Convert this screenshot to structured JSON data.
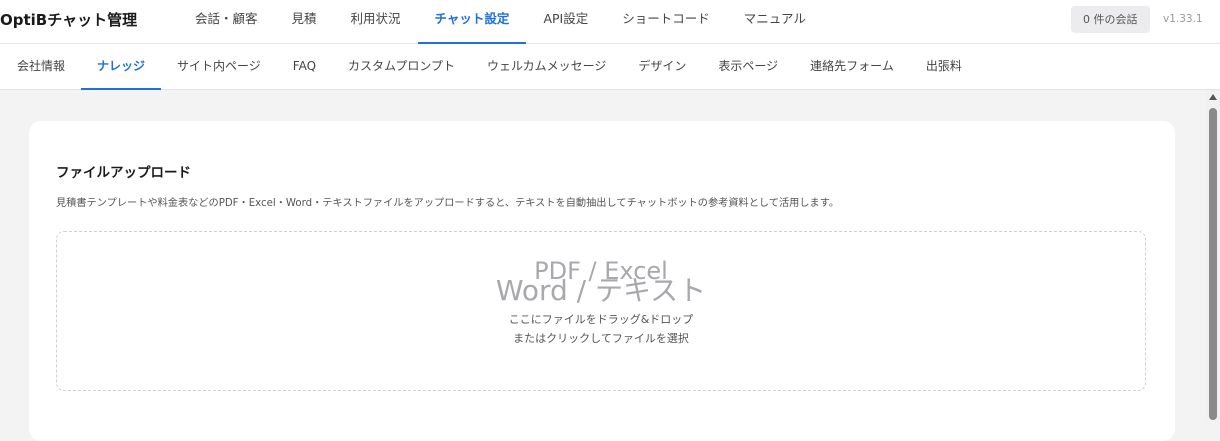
{
  "app": {
    "title": "OptiBチャット管理",
    "session_badge": "0 件の会話",
    "version": "v1.33.1"
  },
  "top_nav": {
    "items": [
      {
        "label": "会話・顧客"
      },
      {
        "label": "見積"
      },
      {
        "label": "利用状況"
      },
      {
        "label": "チャット設定",
        "active": true
      },
      {
        "label": "API設定"
      },
      {
        "label": "ショートコード"
      },
      {
        "label": "マニュアル"
      }
    ]
  },
  "sub_nav": {
    "items": [
      {
        "label": "会社情報"
      },
      {
        "label": "ナレッジ",
        "active": true
      },
      {
        "label": "サイト内ページ"
      },
      {
        "label": "FAQ"
      },
      {
        "label": "カスタムプロンプト"
      },
      {
        "label": "ウェルカムメッセージ"
      },
      {
        "label": "デザイン"
      },
      {
        "label": "表示ページ"
      },
      {
        "label": "連絡先フォーム"
      },
      {
        "label": "出張料"
      }
    ]
  },
  "upload": {
    "title": "ファイルアップロード",
    "description": "見積書テンプレートや料金表などのPDF・Excel・Word・テキストファイルをアップロードすると、テキストを自動抽出してチャットボットの参考資料として活用します。",
    "icon_line1": "PDF / Excel",
    "icon_line2": "Word / テキスト",
    "hint_line1": "ここにファイルをドラッグ&ドロップ",
    "hint_line2": "またはクリックしてファイルを選択"
  },
  "colors": {
    "accent": "#1f6fe0",
    "background": "#f3f3f4"
  }
}
